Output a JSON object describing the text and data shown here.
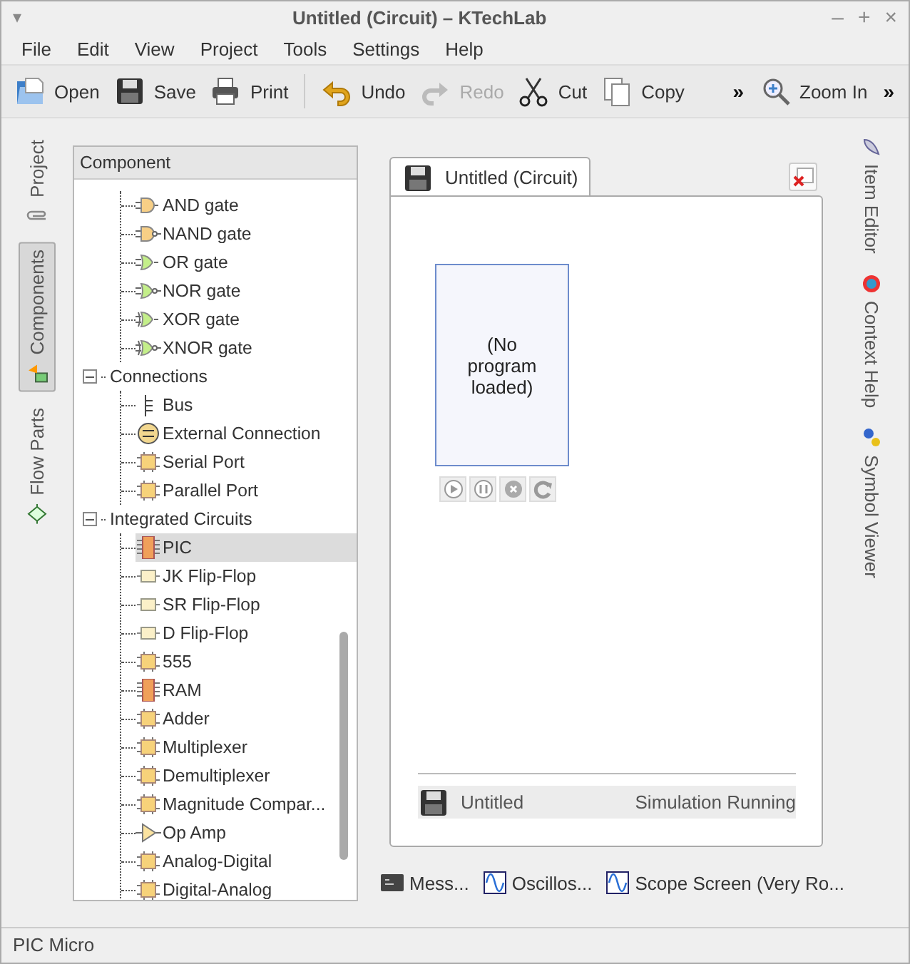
{
  "window": {
    "title": "Untitled (Circuit) – KTechLab",
    "menu_glyph": "▾",
    "controls": [
      "–",
      "+",
      "×"
    ]
  },
  "menu": [
    "File",
    "Edit",
    "View",
    "Project",
    "Tools",
    "Settings",
    "Help"
  ],
  "toolbar": [
    {
      "kind": "open",
      "label": "Open",
      "disabled": false
    },
    {
      "kind": "save",
      "label": "Save",
      "disabled": false
    },
    {
      "kind": "print",
      "label": "Print",
      "disabled": false
    },
    {
      "kind": "separator"
    },
    {
      "kind": "undo",
      "label": "Undo",
      "disabled": false
    },
    {
      "kind": "redo",
      "label": "Redo",
      "disabled": true
    },
    {
      "kind": "cut",
      "label": "Cut",
      "disabled": false
    },
    {
      "kind": "copy",
      "label": "Copy",
      "disabled": false
    },
    {
      "kind": "more",
      "label": "»"
    },
    {
      "kind": "zoom",
      "label": "Zoom In",
      "disabled": false
    },
    {
      "kind": "more",
      "label": "»"
    }
  ],
  "left_tabs": [
    {
      "kind": "project",
      "label": "Project",
      "selected": false
    },
    {
      "kind": "components",
      "label": "Components",
      "selected": true
    },
    {
      "kind": "flow",
      "label": "Flow Parts",
      "selected": false
    }
  ],
  "tree": {
    "header": "Component",
    "items": [
      {
        "kind": "continued",
        "children": [
          {
            "kind": "and",
            "label": "AND gate",
            "selected": false
          },
          {
            "kind": "nand",
            "label": "NAND gate",
            "selected": false
          },
          {
            "kind": "or",
            "label": "OR gate",
            "selected": false
          },
          {
            "kind": "nor",
            "label": "NOR gate",
            "selected": false
          },
          {
            "kind": "xor",
            "label": "XOR gate",
            "selected": false
          },
          {
            "kind": "xnor",
            "label": "XNOR gate",
            "selected": false
          }
        ]
      },
      {
        "kind": "group",
        "label": "Connections",
        "expanded": true,
        "children": [
          {
            "kind": "bus",
            "label": "Bus",
            "selected": false
          },
          {
            "kind": "external",
            "label": "External Connection",
            "selected": false
          },
          {
            "kind": "chip",
            "label": "Serial Port",
            "selected": false
          },
          {
            "kind": "chip",
            "label": "Parallel Port",
            "selected": false
          }
        ]
      },
      {
        "kind": "group",
        "label": "Integrated Circuits",
        "expanded": true,
        "children": [
          {
            "kind": "ic",
            "label": "PIC",
            "selected": true
          },
          {
            "kind": "flipflop",
            "label": "JK Flip-Flop",
            "selected": false
          },
          {
            "kind": "flipflop",
            "label": "SR Flip-Flop",
            "selected": false
          },
          {
            "kind": "flipflop",
            "label": "D Flip-Flop",
            "selected": false
          },
          {
            "kind": "chip",
            "label": "555",
            "selected": false
          },
          {
            "kind": "ic",
            "label": "RAM",
            "selected": false
          },
          {
            "kind": "chip",
            "label": "Adder",
            "selected": false
          },
          {
            "kind": "chip",
            "label": "Multiplexer",
            "selected": false
          },
          {
            "kind": "chip",
            "label": "Demultiplexer",
            "selected": false
          },
          {
            "kind": "chip",
            "label": "Magnitude Compar...",
            "selected": false
          },
          {
            "kind": "opamp",
            "label": "Op Amp",
            "selected": false
          },
          {
            "kind": "chip",
            "label": "Analog-Digital",
            "selected": false
          },
          {
            "kind": "chip",
            "label": "Digital-Analog",
            "selected": false
          }
        ]
      }
    ]
  },
  "document": {
    "tab": "Untitled (Circuit)",
    "pic": {
      "text": "(No program loaded)"
    },
    "status": {
      "name": "Untitled",
      "state": "Simulation Running"
    }
  },
  "right_tabs": [
    {
      "kind": "editor",
      "label": "Item Editor"
    },
    {
      "kind": "help",
      "label": "Context Help"
    },
    {
      "kind": "symbol",
      "label": "Symbol Viewer"
    }
  ],
  "bottom_tabs": [
    {
      "kind": "messages",
      "label": "Mess..."
    },
    {
      "kind": "scope",
      "label": "Oscillos..."
    },
    {
      "kind": "scope",
      "label": "Scope Screen (Very Ro..."
    }
  ],
  "status_bar": "PIC Micro"
}
